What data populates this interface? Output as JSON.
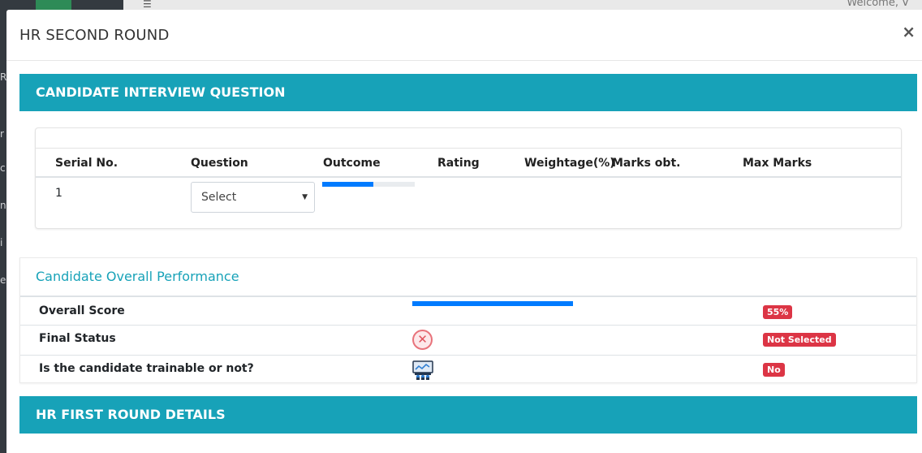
{
  "background": {
    "welcome_text": "Welcome, V",
    "side_letters": [
      "R",
      "r",
      "c",
      "n",
      "i",
      "e"
    ]
  },
  "modal": {
    "title": "HR SECOND ROUND",
    "close_label": "×"
  },
  "interview_section": {
    "header": "CANDIDATE INTERVIEW QUESTION",
    "columns": [
      "Serial No.",
      "Question",
      "Outcome",
      "Rating",
      "Weightage(%)",
      "Marks obt.",
      "Max Marks"
    ],
    "rows": [
      {
        "serial": "1",
        "question_select": "Select",
        "outcome_progress": 0.55
      }
    ]
  },
  "performance": {
    "title": "Candidate Overall Performance",
    "rows": [
      {
        "label": "Overall Score",
        "progress": 1.0,
        "badge": "55%"
      },
      {
        "label": "Final Status",
        "icon": "x-circle-icon",
        "badge": "Not Selected"
      },
      {
        "label": "Is the candidate trainable or not?",
        "icon": "trainable-icon",
        "badge": "No"
      }
    ]
  },
  "first_round_section": {
    "header": "HR FIRST ROUND DETAILS"
  },
  "colors": {
    "teal": "#17a2b8",
    "progress": "#007bff",
    "danger": "#dc3545"
  }
}
